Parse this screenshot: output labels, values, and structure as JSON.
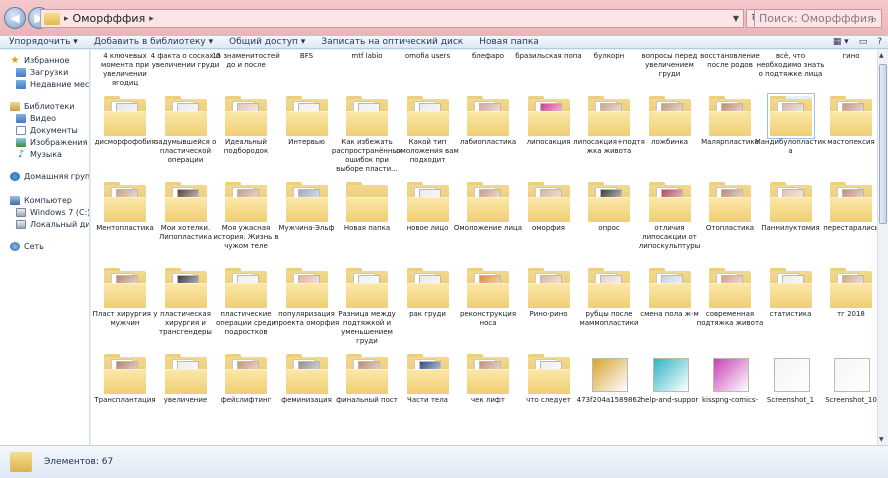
{
  "address_bar": {
    "path_segment": "Оморфффия",
    "search_placeholder": "Поиск: Оморфффия",
    "back_glyph": "◀",
    "forward_glyph": "▶",
    "dropdown_glyph": "▼",
    "separator_glyph": "▸",
    "refresh_glyph": "↻",
    "search_glyph": "⌕"
  },
  "toolbar": {
    "items": [
      "Упорядочить ▾",
      "Добавить в библиотеку ▾",
      "Общий доступ ▾",
      "Записать на оптический диск",
      "Новая папка"
    ],
    "right_icons": [
      "▦ ▾",
      "▭",
      "?"
    ]
  },
  "nav": {
    "favorites": "Избранное",
    "downloads": "Загрузки",
    "recent": "Недавние места",
    "libraries": "Библиотеки",
    "video": "Видео",
    "documents": "Документы",
    "images": "Изображения",
    "music": "Музыка",
    "homegroup": "Домашняя группа",
    "computer": "Компьютер",
    "drive_c": "Windows 7 (C:)",
    "drive_d": "Локальный диск (D",
    "network": "Сеть",
    "star_glyph": "★",
    "music_glyph": "♪"
  },
  "files": [
    {
      "label": "4 ключевых момента при увеличении ягодиц",
      "kind": "folder",
      "tint": "#d9b9a0"
    },
    {
      "label": "4 факта о сосках и увеличении груди",
      "kind": "folder",
      "tint": "#e8c8b4"
    },
    {
      "label": "15 знаменитостей до и после",
      "kind": "folder",
      "tint": "#c9a58a"
    },
    {
      "label": "BFS",
      "kind": "folder",
      "tint": "#d4b59b"
    },
    {
      "label": "mtf labio",
      "kind": "folder",
      "tint": "#ddd"
    },
    {
      "label": "omofia users",
      "kind": "folder",
      "tint": "#c98f7a"
    },
    {
      "label": "блефаро",
      "kind": "folder",
      "tint": "#b8896f"
    },
    {
      "label": "бразильская попа",
      "kind": "folder",
      "tint": "#caa08a"
    },
    {
      "label": "булкорн",
      "kind": "folder",
      "tint": "#d4aa90"
    },
    {
      "label": "вопросы перед увеличением груди",
      "kind": "folder",
      "tint": "#e2c2ae"
    },
    {
      "label": "восстановление после родов",
      "kind": "folder",
      "tint": "#c7a48d"
    },
    {
      "label": "всё, что необходимо знать о подтяжке лица",
      "kind": "folder",
      "tint": "#eee"
    },
    {
      "label": "гино",
      "kind": "folder",
      "tint": "#d8b49a"
    },
    {
      "label": "дисморфофобия",
      "kind": "folder",
      "tint": "#e6e6ea"
    },
    {
      "label": "задумывшейся о пластической операции",
      "kind": "folder",
      "tint": "#e9e9ee"
    },
    {
      "label": "Идеальный подбородок",
      "kind": "folder",
      "tint": "#e0c6b6"
    },
    {
      "label": "Интервью",
      "kind": "folder",
      "tint": "#efefef"
    },
    {
      "label": "Как избежать распространённых ошибок при выборе пласти...",
      "kind": "folder",
      "tint": "#efefef"
    },
    {
      "label": "Какой тип омоложения вам подходит",
      "kind": "folder",
      "tint": "#eaeaea"
    },
    {
      "label": "лабиопластика",
      "kind": "folder",
      "tint": "#d5a7a0"
    },
    {
      "label": "липосакция",
      "kind": "folder",
      "tint": "#d03f8a"
    },
    {
      "label": "липосакция+подтяжка живота",
      "kind": "folder",
      "tint": "#caa591"
    },
    {
      "label": "ложбинка",
      "kind": "folder",
      "tint": "#c49a80"
    },
    {
      "label": "Малярпластика",
      "kind": "folder",
      "tint": "#c28b73"
    },
    {
      "label": "Мандибулопластика",
      "kind": "folder",
      "tint": "#d2b9a8",
      "selected": true
    },
    {
      "label": "мастопексия",
      "kind": "folder",
      "tint": "#c99680"
    },
    {
      "label": "Ментопластика",
      "kind": "folder",
      "tint": "#c7a18d"
    },
    {
      "label": "Мои хотелки. Липопластика",
      "kind": "folder",
      "tint": "#5a4438"
    },
    {
      "label": "Моя ужасная история. Жизнь в чужом теле",
      "kind": "folder",
      "tint": "#c49c84"
    },
    {
      "label": "Мужчина-Эльф",
      "kind": "folder",
      "tint": "#9ea8c4"
    },
    {
      "label": "Новая папка",
      "kind": "empty",
      "tint": ""
    },
    {
      "label": "новое лицо",
      "kind": "folder",
      "tint": "#eaeaea"
    },
    {
      "label": "Омоложение лица",
      "kind": "folder",
      "tint": "#c99f88"
    },
    {
      "label": "оморфия",
      "kind": "folder",
      "tint": "#d6b3a2"
    },
    {
      "label": "опрос",
      "kind": "folder",
      "tint": "#3d3d3d"
    },
    {
      "label": "отличия липосакции от липоскульптуры",
      "kind": "folder",
      "tint": "#b04d5a"
    },
    {
      "label": "Отопластика",
      "kind": "folder",
      "tint": "#b78a72"
    },
    {
      "label": "Паннилуктомия",
      "kind": "folder",
      "tint": "#e3c2ad"
    },
    {
      "label": "перестарались",
      "kind": "folder",
      "tint": "#c08e79"
    },
    {
      "label": "Пласт хирургия у мужчин",
      "kind": "folder",
      "tint": "#b58a72"
    },
    {
      "label": "пластическая хирургия и трансгендеры",
      "kind": "folder",
      "tint": "#3b3b44"
    },
    {
      "label": "пластические операции среди подростков",
      "kind": "folder",
      "tint": "#efefef"
    },
    {
      "label": "популяризация проекта оморфия",
      "kind": "folder",
      "tint": "#e3b0a0"
    },
    {
      "label": "Разница между подтяжкой и уменьшением груди",
      "kind": "folder",
      "tint": "#f0f0f0"
    },
    {
      "label": "рак груди",
      "kind": "folder",
      "tint": "#e8e8e8"
    },
    {
      "label": "реконструкция носа",
      "kind": "folder",
      "tint": "#e08a3c"
    },
    {
      "label": "Рино-рино",
      "kind": "folder",
      "tint": "#d9b6a3"
    },
    {
      "label": "рубцы после маммопластики",
      "kind": "folder",
      "tint": "#e7d3cb"
    },
    {
      "label": "смена пола ж-м",
      "kind": "folder",
      "tint": "#c7d3ea"
    },
    {
      "label": "современная подтяжка живота",
      "kind": "folder",
      "tint": "#d3a088"
    },
    {
      "label": "статистика",
      "kind": "folder",
      "tint": "#ececec"
    },
    {
      "label": "тг 2018",
      "kind": "folder",
      "tint": "#d1a98c"
    },
    {
      "label": "Трансплантация",
      "kind": "folder",
      "tint": "#b6826d"
    },
    {
      "label": "увеличение",
      "kind": "folder",
      "tint": "#ececec"
    },
    {
      "label": "фейслифтинг",
      "kind": "folder",
      "tint": "#c9937b"
    },
    {
      "label": "феминизация",
      "kind": "folder",
      "tint": "#8f8f8f"
    },
    {
      "label": "финальный пост",
      "kind": "folder",
      "tint": "#b88a72"
    },
    {
      "label": "Части тела",
      "kind": "folder",
      "tint": "#334f88"
    },
    {
      "label": "чек лифт",
      "kind": "folder",
      "tint": "#c39178"
    },
    {
      "label": "что следует",
      "kind": "folder",
      "tint": "#eeeeee"
    },
    {
      "label": "473f204a1589862",
      "kind": "image",
      "tint": "#d6a32f"
    },
    {
      "label": "help-and-suppor",
      "kind": "image",
      "tint": "#2fb4c4"
    },
    {
      "label": "kisspng-comics-",
      "kind": "image",
      "tint": "#c83fb8"
    },
    {
      "label": "Screenshot_1",
      "kind": "image",
      "tint": "#f4f4f4"
    },
    {
      "label": "Screenshot_10",
      "kind": "image",
      "tint": "#f6f6f6"
    }
  ],
  "status": {
    "count_text": "Элементов: 67"
  },
  "scrollbar": {
    "up_glyph": "▲",
    "down_glyph": "▼"
  }
}
